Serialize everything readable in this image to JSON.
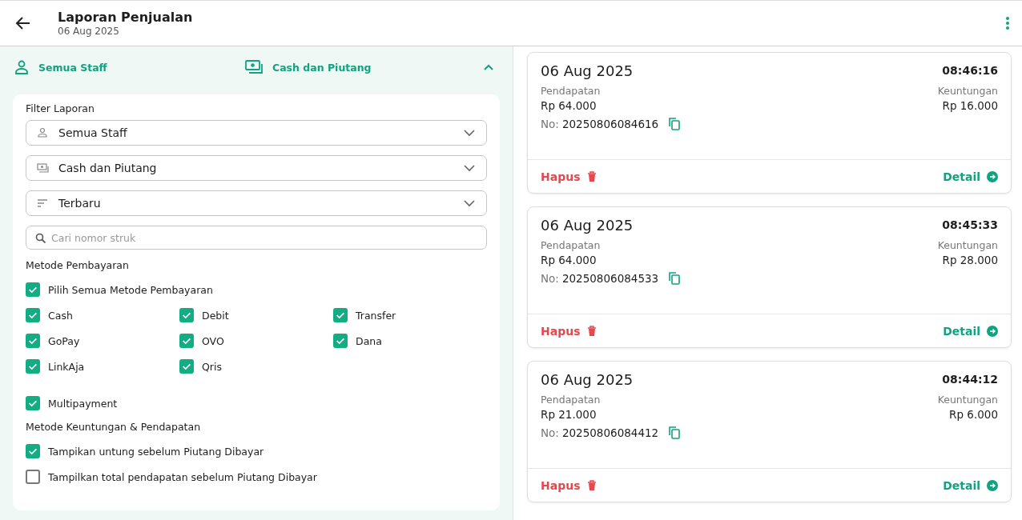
{
  "header": {
    "title": "Laporan Penjualan",
    "subtitle": "06 Aug 2025"
  },
  "summary": {
    "staff": "Semua Staff",
    "payment": "Cash dan Piutang",
    "expanded": true
  },
  "filter": {
    "title": "Filter Laporan",
    "dropdowns": [
      {
        "kind": "person",
        "value": "Semua Staff"
      },
      {
        "kind": "money",
        "value": "Cash dan Piutang"
      },
      {
        "kind": "sort",
        "value": "Terbaru"
      }
    ],
    "search": {
      "placeholder": "Cari nomor struk"
    }
  },
  "payment": {
    "title": "Metode Pembayaran",
    "select_all": {
      "label": "Pilih Semua Metode Pembayaran",
      "checked": true
    },
    "methods": [
      {
        "label": "Cash",
        "checked": true
      },
      {
        "label": "Debit",
        "checked": true
      },
      {
        "label": "Transfer",
        "checked": true
      },
      {
        "label": "GoPay",
        "checked": true
      },
      {
        "label": "OVO",
        "checked": true
      },
      {
        "label": "Dana",
        "checked": true
      },
      {
        "label": "LinkAja",
        "checked": true
      },
      {
        "label": "Qris",
        "checked": true
      }
    ],
    "multipayment": {
      "label": "Multipayment",
      "checked": true
    }
  },
  "profit": {
    "title": "Metode Keuntungan & Pendapatan",
    "options": [
      {
        "label": "Tampikan untung sebelum Piutang Dibayar",
        "checked": true
      },
      {
        "label": "Tampilkan total pendapatan sebelum Piutang Dibayar",
        "checked": false
      }
    ]
  },
  "transactions": [
    {
      "date": "06 Aug 2025",
      "time": "08:46:16",
      "revenue_label": "Pendapatan",
      "revenue": "Rp 64.000",
      "profit_label": "Keuntungan",
      "profit": "Rp 16.000",
      "no_label": "No:",
      "number": "20250806084616",
      "delete": "Hapus",
      "detail": "Detail"
    },
    {
      "date": "06 Aug 2025",
      "time": "08:45:33",
      "revenue_label": "Pendapatan",
      "revenue": "Rp 64.000",
      "profit_label": "Keuntungan",
      "profit": "Rp 28.000",
      "no_label": "No:",
      "number": "20250806084533",
      "delete": "Hapus",
      "detail": "Detail"
    },
    {
      "date": "06 Aug 2025",
      "time": "08:44:12",
      "revenue_label": "Pendapatan",
      "revenue": "Rp 21.000",
      "profit_label": "Keuntungan",
      "profit": "Rp 6.000",
      "no_label": "No:",
      "number": "20250806084412",
      "delete": "Hapus",
      "detail": "Detail"
    }
  ]
}
